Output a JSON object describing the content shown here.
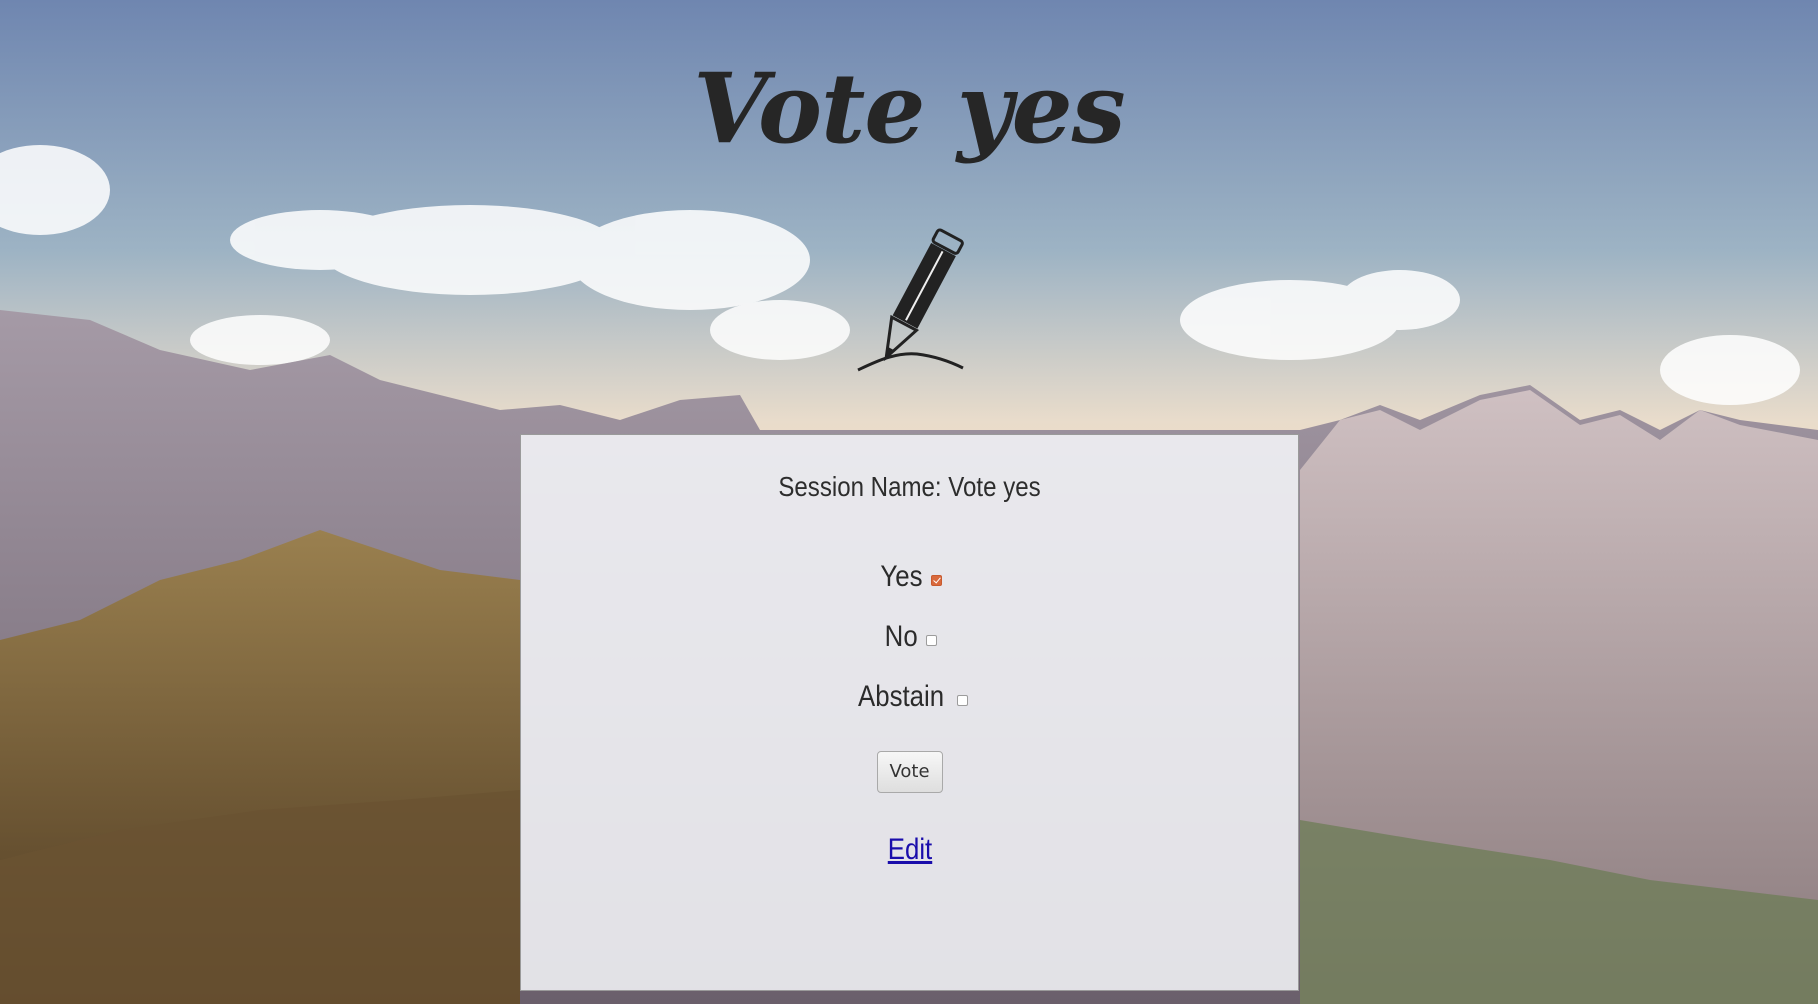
{
  "page": {
    "title": "Vote yes",
    "session_label": "Session Name: Vote yes"
  },
  "icons": {
    "hero": "pencil-icon"
  },
  "ballot": {
    "options": [
      {
        "label": "Yes",
        "checked": true
      },
      {
        "label": "No",
        "checked": false
      },
      {
        "label": "Abstain",
        "checked": false
      }
    ],
    "vote_label": "Vote"
  },
  "links": {
    "edit_label": "Edit"
  },
  "colors": {
    "checkbox_checked": "#d9693c",
    "link": "#1a0dab",
    "title": "#262626"
  }
}
